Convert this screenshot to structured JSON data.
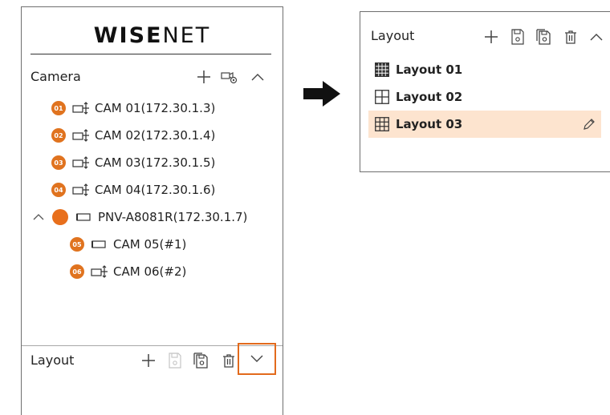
{
  "left_panel": {
    "logo": {
      "bold": "WISE",
      "thin": "NET"
    },
    "camera_section": {
      "title": "Camera",
      "items": [
        {
          "badge": "01",
          "label": "CAM 01(172.30.1.3)"
        },
        {
          "badge": "02",
          "label": "CAM 02(172.30.1.4)"
        },
        {
          "badge": "03",
          "label": "CAM 03(172.30.1.5)"
        },
        {
          "badge": "04",
          "label": "CAM 04(172.30.1.6)"
        }
      ],
      "nvr_group": {
        "label": "PNV-A8081R(172.30.1.7)",
        "children": [
          {
            "badge": "05",
            "label": "CAM 05(#1)"
          },
          {
            "badge": "06",
            "label": "CAM 06(#2)"
          }
        ]
      }
    },
    "layout_section": {
      "title": "Layout"
    }
  },
  "right_panel": {
    "layout_section": {
      "title": "Layout",
      "items": [
        {
          "label": "Layout 01",
          "grid": "4x4",
          "selected": false
        },
        {
          "label": "Layout 02",
          "grid": "2x2",
          "selected": false
        },
        {
          "label": "Layout 03",
          "grid": "3x3",
          "selected": true
        }
      ]
    }
  },
  "colors": {
    "badge_orange": "#e0731f",
    "highlight_border": "#e26a1c",
    "selected_row": "#fde4cf",
    "arrow": "#111111"
  }
}
